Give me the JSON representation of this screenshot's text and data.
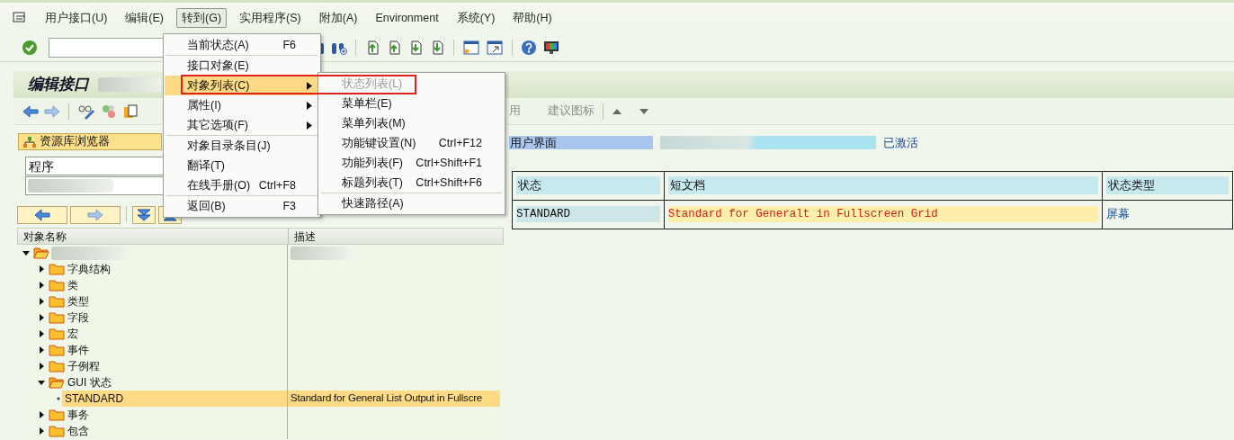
{
  "menubar": [
    {
      "label": "用户接口(U)",
      "selected": false
    },
    {
      "label": "编辑(E)",
      "selected": false
    },
    {
      "label": "转到(G)",
      "selected": true
    },
    {
      "label": "实用程序(S)",
      "selected": false
    },
    {
      "label": "附加(A)",
      "selected": false
    },
    {
      "label": "Environment",
      "selected": false
    },
    {
      "label": "系统(Y)",
      "selected": false
    },
    {
      "label": "帮助(H)",
      "selected": false
    }
  ],
  "goto_menu": [
    {
      "kind": "item",
      "label": "当前状态(A)",
      "shortcut": "F6",
      "submenu": false,
      "selected": false
    },
    {
      "kind": "separator"
    },
    {
      "kind": "item",
      "label": "接口对象(E)",
      "submenu": false,
      "selected": false
    },
    {
      "kind": "item",
      "label": "对象列表(C)",
      "submenu": true,
      "selected": true
    },
    {
      "kind": "item",
      "label": "属性(I)",
      "submenu": true,
      "selected": false
    },
    {
      "kind": "item",
      "label": "其它选项(F)",
      "submenu": true,
      "selected": false
    },
    {
      "kind": "separator"
    },
    {
      "kind": "item",
      "label": "对象目录条目(J)",
      "submenu": false,
      "selected": false
    },
    {
      "kind": "item",
      "label": "翻译(T)",
      "submenu": false,
      "selected": false
    },
    {
      "kind": "item",
      "label": "在线手册(O)",
      "shortcut": "Ctrl+F8",
      "submenu": false,
      "selected": false
    },
    {
      "kind": "separator"
    },
    {
      "kind": "item",
      "label": "返回(B)",
      "shortcut": "F3",
      "submenu": false,
      "selected": false
    }
  ],
  "object_list_submenu": [
    {
      "kind": "item",
      "label": "状态列表(L)",
      "disabled": true
    },
    {
      "kind": "item",
      "label": "菜单栏(E)",
      "disabled": false
    },
    {
      "kind": "item",
      "label": "菜单列表(M)",
      "disabled": false
    },
    {
      "kind": "item",
      "label": "功能键设置(N)",
      "shortcut": "Ctrl+F12",
      "disabled": false
    },
    {
      "kind": "item",
      "label": "功能列表(F)",
      "shortcut": "Ctrl+Shift+F1",
      "disabled": false
    },
    {
      "kind": "item",
      "label": "标题列表(T)",
      "shortcut": "Ctrl+Shift+F6",
      "disabled": false
    },
    {
      "kind": "separator"
    },
    {
      "kind": "item",
      "label": "快速路径(A)",
      "disabled": false
    }
  ],
  "title": "编辑接口",
  "app_toolbar": [
    "用",
    "建议图标"
  ],
  "repository_browser": {
    "button": "资源库浏览器",
    "object_type": "程序"
  },
  "tree": {
    "columns": [
      "对象名称",
      "描述"
    ],
    "nodes": [
      {
        "expanded": true,
        "selected": false,
        "children": [
          {
            "label": "字典结构",
            "expanded": false,
            "selected": false
          },
          {
            "label": "类",
            "expanded": false,
            "selected": false
          },
          {
            "label": "类型",
            "expanded": false,
            "selected": false
          },
          {
            "label": "字段",
            "expanded": false,
            "selected": false
          },
          {
            "label": "宏",
            "expanded": false,
            "selected": false
          },
          {
            "label": "事件",
            "expanded": false,
            "selected": false
          },
          {
            "label": "子例程",
            "expanded": false,
            "selected": false
          },
          {
            "label": "GUI 状态",
            "expanded": true,
            "selected": false,
            "children": [
              {
                "kind": "leaf",
                "label": "STANDARD",
                "description": "Standard for General List Output in Fullscre",
                "selected": true
              }
            ]
          },
          {
            "label": "事务",
            "expanded": false,
            "selected": false
          },
          {
            "label": "包含",
            "expanded": false,
            "selected": false
          }
        ]
      }
    ]
  },
  "interface_header": {
    "label": "用户界面",
    "status": "已激活"
  },
  "status_table": {
    "columns": [
      "状态",
      "短文档",
      "状态类型"
    ],
    "rows": [
      [
        "STANDARD",
        "Standard for Generalt in Fullscreen Grid",
        "屏幕"
      ]
    ]
  }
}
